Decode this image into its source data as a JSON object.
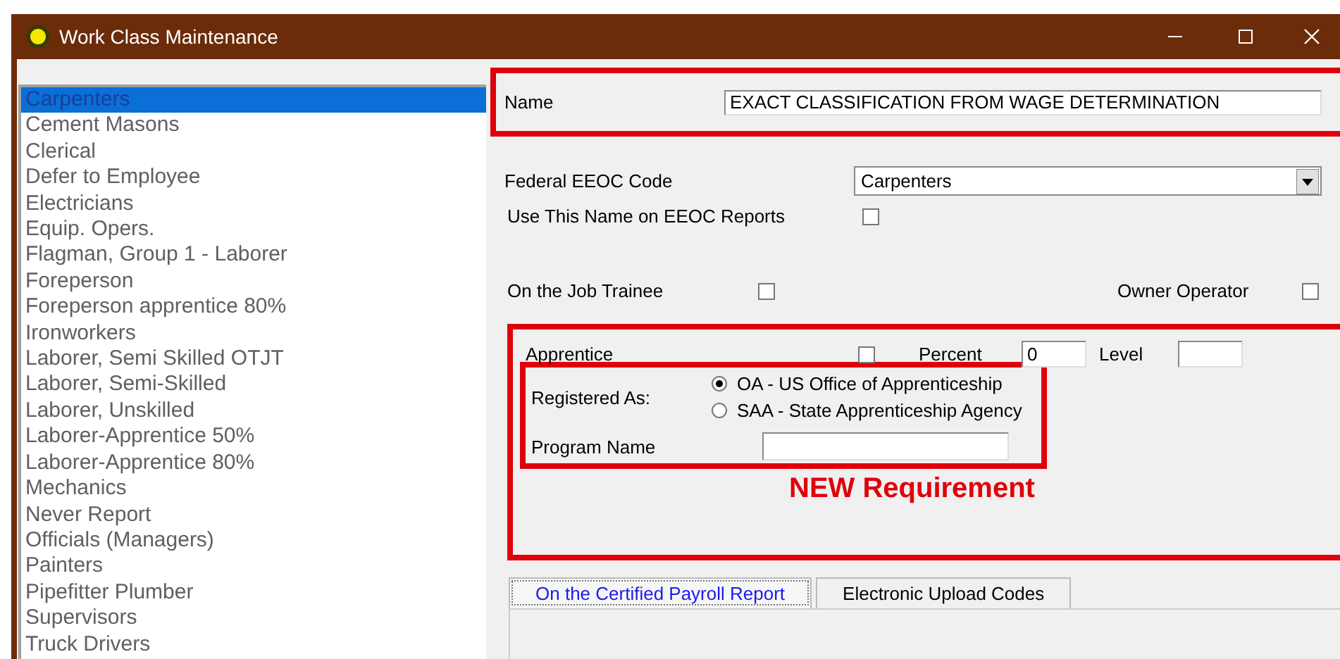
{
  "window": {
    "title": "Work Class Maintenance"
  },
  "work_classes": [
    {
      "label": "Carpenters",
      "selected": true
    },
    {
      "label": "Cement Masons",
      "selected": false
    },
    {
      "label": "Clerical",
      "selected": false
    },
    {
      "label": "Defer to Employee",
      "selected": false
    },
    {
      "label": "Electricians",
      "selected": false
    },
    {
      "label": "Equip. Opers.",
      "selected": false
    },
    {
      "label": "Flagman, Group 1 - Laborer",
      "selected": false
    },
    {
      "label": "Foreperson",
      "selected": false
    },
    {
      "label": "Foreperson apprentice 80%",
      "selected": false
    },
    {
      "label": "Ironworkers",
      "selected": false
    },
    {
      "label": "Laborer, Semi Skilled OTJT",
      "selected": false
    },
    {
      "label": "Laborer, Semi-Skilled",
      "selected": false
    },
    {
      "label": "Laborer, Unskilled",
      "selected": false
    },
    {
      "label": "Laborer-Apprentice 50%",
      "selected": false
    },
    {
      "label": "Laborer-Apprentice 80%",
      "selected": false
    },
    {
      "label": "Mechanics",
      "selected": false
    },
    {
      "label": "Never Report",
      "selected": false
    },
    {
      "label": "Officials (Managers)",
      "selected": false
    },
    {
      "label": "Painters",
      "selected": false
    },
    {
      "label": "Pipefitter Plumber",
      "selected": false
    },
    {
      "label": "Supervisors",
      "selected": false
    },
    {
      "label": "Truck Drivers",
      "selected": false
    }
  ],
  "name_field": {
    "label": "Name",
    "value": "EXACT CLASSIFICATION FROM WAGE DETERMINATION"
  },
  "eeoc_code": {
    "label": "Federal EEOC Code",
    "value": "Carpenters"
  },
  "use_name_on_eeoc": {
    "label": "Use This Name on EEOC Reports",
    "checked": false
  },
  "on_the_job_trainee": {
    "label": "On the Job Trainee",
    "checked": false
  },
  "owner_operator": {
    "label": "Owner Operator",
    "checked": false
  },
  "apprentice": {
    "label": "Apprentice",
    "checked": false
  },
  "percent": {
    "label": "Percent",
    "value": "0"
  },
  "level": {
    "label": "Level"
  },
  "registered_as": {
    "label": "Registered As:",
    "options": [
      {
        "label": "OA - US Office of Apprenticeship",
        "selected": true
      },
      {
        "label": "SAA - State Apprenticeship Agency",
        "selected": false
      }
    ]
  },
  "program_name": {
    "label": "Program Name"
  },
  "annotation": "NEW Requirement",
  "tabs": [
    {
      "label": "On the Certified Payroll Report",
      "selected": true
    },
    {
      "label": "Electronic Upload Codes",
      "selected": false
    }
  ]
}
